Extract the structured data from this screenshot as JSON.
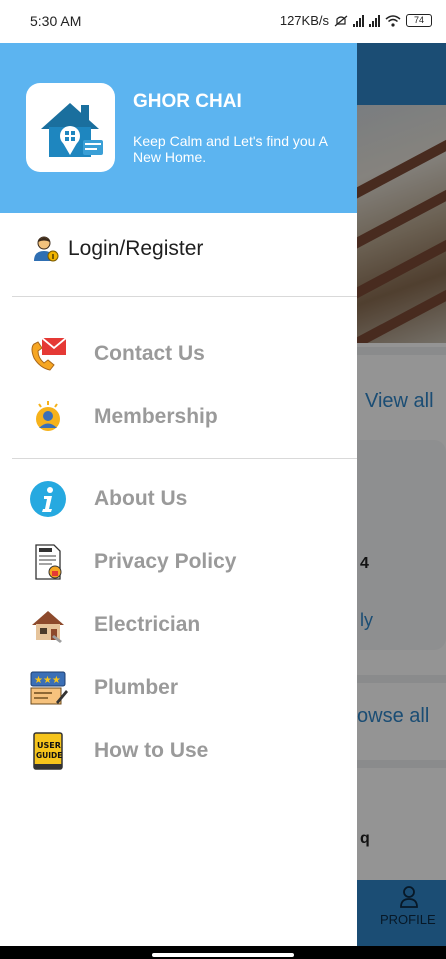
{
  "status_bar": {
    "time": "5:30 AM",
    "net_speed": "127KB/s",
    "battery": "74"
  },
  "background": {
    "view_all": "View all",
    "text_4": "4",
    "text_ly": "ly",
    "browse_all": "owse all",
    "text_q": "q",
    "profile_label": "PROFILE"
  },
  "drawer": {
    "header": {
      "app_name": "GHOR CHAI",
      "tagline": "Keep Calm and Let's find you A New Home.",
      "header_color": "#5cb4f0"
    },
    "login_label": "Login/Register",
    "section_one": [
      {
        "label": "Contact Us",
        "icon": "phone-mail-icon"
      },
      {
        "label": "Membership",
        "icon": "member-avatar-icon"
      }
    ],
    "section_two": [
      {
        "label": "About Us",
        "icon": "info-icon"
      },
      {
        "label": "Privacy Policy",
        "icon": "policy-document-icon"
      },
      {
        "label": "Electrician",
        "icon": "electrician-house-icon"
      },
      {
        "label": "Plumber",
        "icon": "plumber-rating-icon"
      },
      {
        "label": "How to Use",
        "icon": "user-guide-icon"
      }
    ]
  },
  "colors": {
    "accent": "#2f86c8",
    "menu_text": "#9a9a9a"
  }
}
